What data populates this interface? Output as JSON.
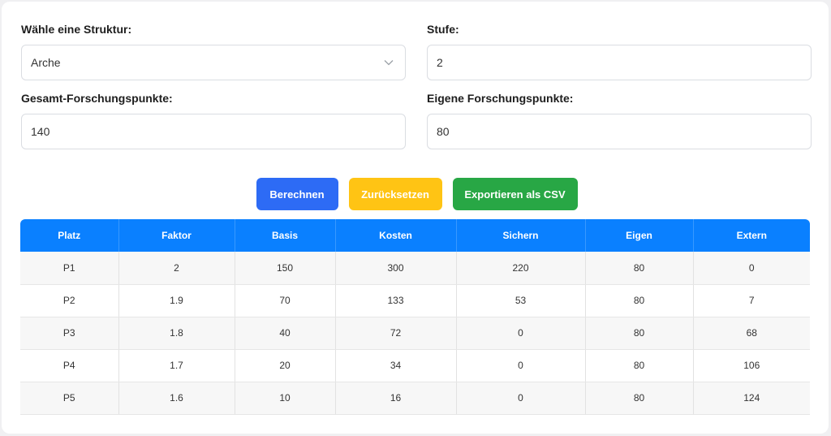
{
  "form": {
    "structure_label": "Wähle eine Struktur:",
    "structure_value": "Arche",
    "stufe_label": "Stufe:",
    "stufe_value": "2",
    "total_label": "Gesamt-Forschungspunkte:",
    "total_value": "140",
    "own_label": "Eigene Forschungspunkte:",
    "own_value": "80"
  },
  "buttons": {
    "calculate": "Berechnen",
    "reset": "Zurücksetzen",
    "export": "Exportieren als CSV"
  },
  "colors": {
    "primary": "#2d6bf5",
    "warning": "#ffc414",
    "success": "#28a745",
    "table_header": "#0a80ff"
  },
  "icons": {
    "dropdown": "chevron-down-icon"
  },
  "table": {
    "headers": [
      "Platz",
      "Faktor",
      "Basis",
      "Kosten",
      "Sichern",
      "Eigen",
      "Extern"
    ],
    "rows": [
      [
        "P1",
        "2",
        "150",
        "300",
        "220",
        "80",
        "0"
      ],
      [
        "P2",
        "1.9",
        "70",
        "133",
        "53",
        "80",
        "7"
      ],
      [
        "P3",
        "1.8",
        "40",
        "72",
        "0",
        "80",
        "68"
      ],
      [
        "P4",
        "1.7",
        "20",
        "34",
        "0",
        "80",
        "106"
      ],
      [
        "P5",
        "1.6",
        "10",
        "16",
        "0",
        "80",
        "124"
      ]
    ]
  }
}
